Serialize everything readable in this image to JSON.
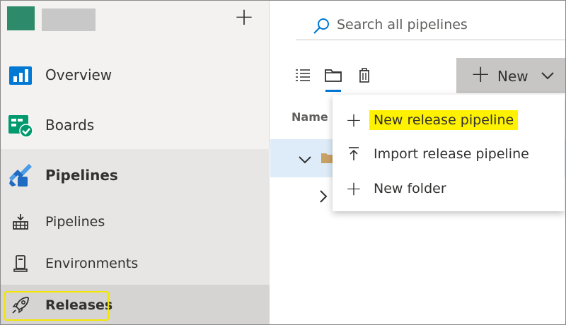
{
  "sidebar": {
    "add_icon": "plus-icon",
    "items": [
      {
        "label": "Overview",
        "icon": "overview-icon"
      },
      {
        "label": "Boards",
        "icon": "boards-icon"
      },
      {
        "label": "Pipelines",
        "icon": "pipelines-icon"
      }
    ],
    "sub_items": [
      {
        "label": "Pipelines",
        "icon": "pipeline-build-icon"
      },
      {
        "label": "Environments",
        "icon": "environment-icon"
      },
      {
        "label": "Releases",
        "icon": "rocket-icon"
      }
    ]
  },
  "main": {
    "search_placeholder": "Search all pipelines",
    "new_button_label": "New",
    "column_name": "Name"
  },
  "menu": {
    "items": [
      {
        "label": "New release pipeline",
        "icon": "plus-icon"
      },
      {
        "label": "Import release pipeline",
        "icon": "import-icon"
      },
      {
        "label": "New folder",
        "icon": "plus-icon"
      }
    ]
  },
  "colors": {
    "accent": "#0078d4",
    "highlight": "#fff200",
    "org_avatar": "#2d8a6a"
  }
}
